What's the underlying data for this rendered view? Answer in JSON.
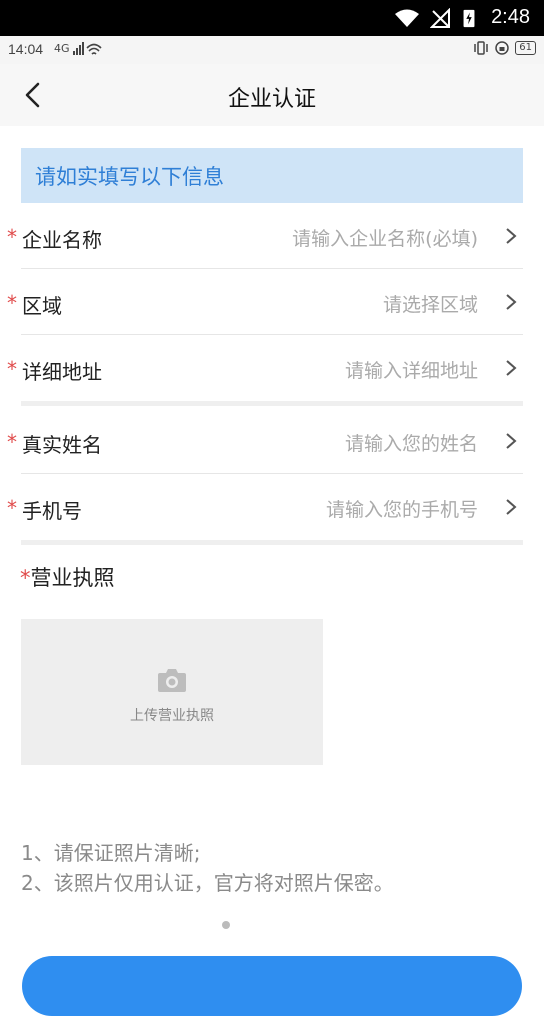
{
  "system_bar": {
    "time": "2:48"
  },
  "app_status": {
    "time": "14:04",
    "signal": "4G",
    "battery": "61"
  },
  "header": {
    "title": "企业认证"
  },
  "banner": {
    "text": "请如实填写以下信息"
  },
  "form": {
    "required_mark": "*",
    "fields": [
      {
        "label": "企业名称",
        "placeholder": "请输入企业名称(必填)"
      },
      {
        "label": "区域",
        "placeholder": "请选择区域"
      },
      {
        "label": "详细地址",
        "placeholder": "请输入详细地址"
      },
      {
        "label": "真实姓名",
        "placeholder": "请输入您的姓名"
      },
      {
        "label": "手机号",
        "placeholder": "请输入您的手机号"
      }
    ]
  },
  "license": {
    "label": "营业执照",
    "upload_text": "上传营业执照"
  },
  "notes": [
    "1、请保证照片清晰;",
    "2、该照片仅用认证，官方将对照片保密。"
  ],
  "colors": {
    "accent": "#2f8ef0",
    "banner_bg": "#cfe4f7",
    "banner_text": "#2f7fd6",
    "required": "#e04b4b"
  }
}
